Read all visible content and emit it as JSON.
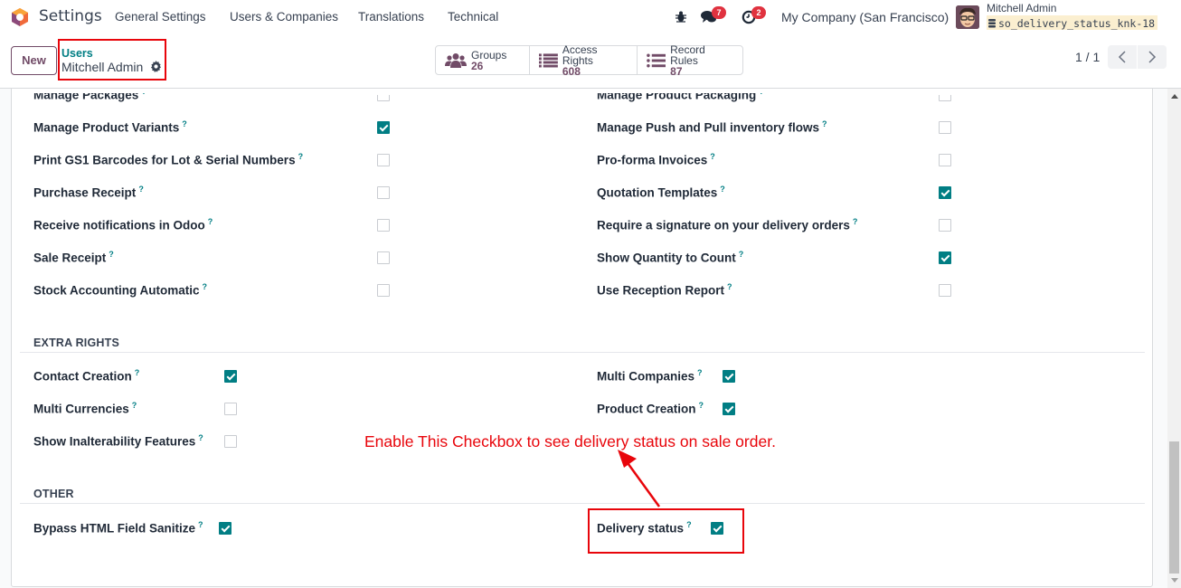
{
  "navbar": {
    "app_name": "Settings",
    "menu": [
      "General Settings",
      "Users & Companies",
      "Translations",
      "Technical"
    ],
    "icons": [
      "debug-icon",
      "messages-icon",
      "activity-icon"
    ],
    "messages_badge": "7",
    "activity_badge": "2",
    "company": "My Company (San Francisco)",
    "user_name": "Mitchell Admin",
    "database": "so_delivery_status_knk-18"
  },
  "control_panel": {
    "new_label": "New",
    "breadcrumb_parent": "Users",
    "breadcrumb_current": "Mitchell Admin",
    "smart_buttons": [
      {
        "label": "Groups",
        "value": "26",
        "icon": "users-icon"
      },
      {
        "label": "Access Rights",
        "value": "608",
        "icon": "list-icon"
      },
      {
        "label": "Record Rules",
        "value": "87",
        "icon": "list-ul-icon"
      }
    ],
    "pager": "1 / 1",
    "pager_prev": "‹",
    "pager_next": "›"
  },
  "help_marker": "?",
  "technical_left": [
    {
      "label": "Manage Packages",
      "checked": false
    },
    {
      "label": "Manage Product Variants",
      "checked": true
    },
    {
      "label": "Print GS1 Barcodes for Lot & Serial Numbers",
      "checked": false
    },
    {
      "label": "Purchase Receipt",
      "checked": false
    },
    {
      "label": "Receive notifications in Odoo",
      "checked": false
    },
    {
      "label": "Sale Receipt",
      "checked": false
    },
    {
      "label": "Stock Accounting Automatic",
      "checked": false
    }
  ],
  "technical_right": [
    {
      "label": "Manage Product Packaging",
      "checked": false
    },
    {
      "label": "Manage Push and Pull inventory flows",
      "checked": false
    },
    {
      "label": "Pro-forma Invoices",
      "checked": false
    },
    {
      "label": "Quotation Templates",
      "checked": true
    },
    {
      "label": "Require a signature on your delivery orders",
      "checked": false
    },
    {
      "label": "Show Quantity to Count",
      "checked": true
    },
    {
      "label": "Use Reception Report",
      "checked": false
    }
  ],
  "extra_rights": {
    "title": "EXTRA RIGHTS",
    "left": [
      {
        "label": "Contact Creation",
        "checked": true
      },
      {
        "label": "Multi Currencies",
        "checked": false
      },
      {
        "label": "Show Inalterability Features",
        "checked": false
      }
    ],
    "right": [
      {
        "label": "Multi Companies",
        "checked": true
      },
      {
        "label": "Product Creation",
        "checked": true
      }
    ]
  },
  "other": {
    "title": "OTHER",
    "left": [
      {
        "label": "Bypass HTML Field Sanitize",
        "checked": true
      }
    ],
    "right": [
      {
        "label": "Delivery status",
        "checked": true
      }
    ]
  },
  "annotation": {
    "text": "Enable This Checkbox to see delivery status on sale order.",
    "color": "#e8050b"
  },
  "colors": {
    "primary": "#714b67",
    "accent": "#017e84",
    "badge": "#e0323f"
  }
}
